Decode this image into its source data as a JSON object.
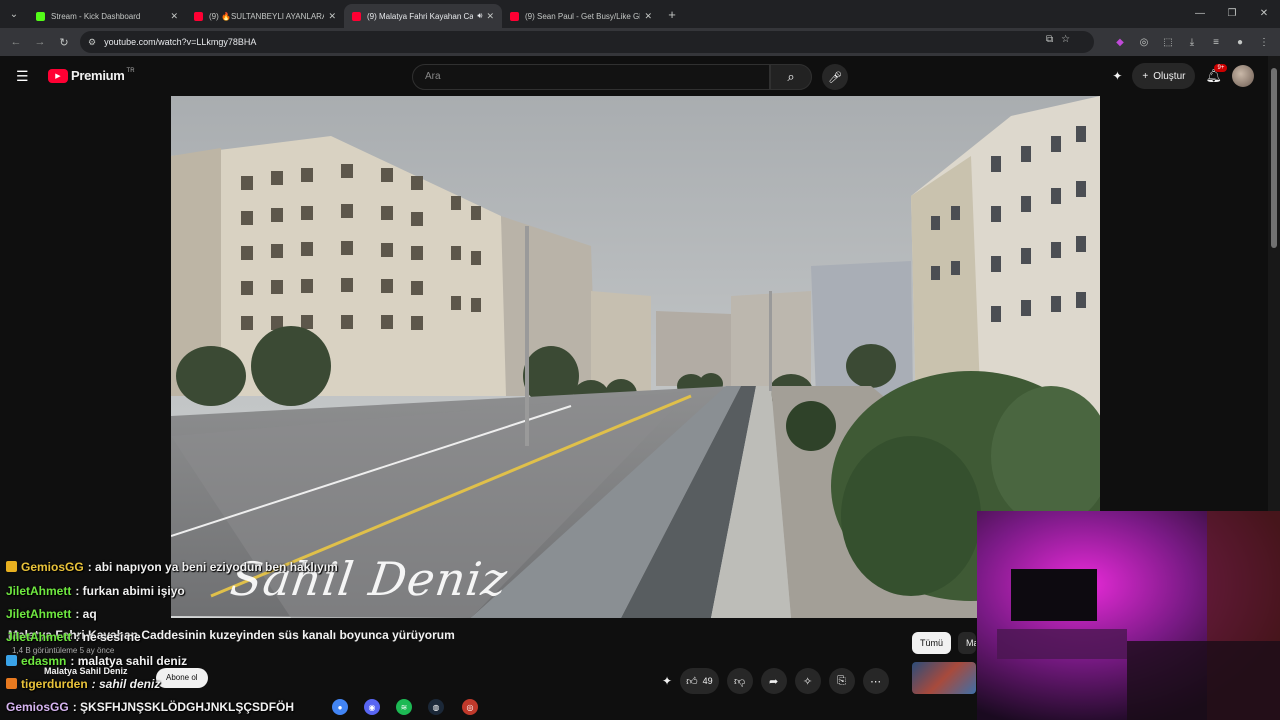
{
  "browser": {
    "tabs": [
      {
        "title": "Stream - Kick Dashboard",
        "favicon_color": "#53fc18",
        "active": false
      },
      {
        "title": "(9) 🔥SULTANBEYLI AYANLARA",
        "favicon_color": "#ff0033",
        "active": false
      },
      {
        "title": "(9) Malatya Fahri Kayahan Ca",
        "favicon_color": "#ff0033",
        "active": true
      },
      {
        "title": "(9) Sean Paul - Get Busy/Like Gl",
        "favicon_color": "#ff0033",
        "active": false
      }
    ],
    "url": "youtube.com/watch?v=LLkmgy78BHA"
  },
  "youtube": {
    "brand": "Premium",
    "country": "TR",
    "search_placeholder": "Ara",
    "create_label": "Oluştur",
    "notifications": "9+"
  },
  "video": {
    "watermark": "Sahil Deniz",
    "title": "Malatya Fahri Kayahan Caddesinin kuzeyinden süs kanalı boyunca yürüyorum",
    "meta": "1,4 B görüntüleme  5 ay önce",
    "channel": "Malatya Sahil Deniz",
    "subscribe_label": "Abone ol",
    "likes": "49",
    "chips": [
      "Tümü",
      "Ma"
    ]
  },
  "chat": [
    {
      "user": "GemiosGG",
      "user_color": "#e8c23a",
      "text": ": abi napıyon ya beni eziyodun ben haklıyım",
      "badge_color": "#e8b020"
    },
    {
      "user": "JiletAhmett",
      "user_color": "#6fe840",
      "text": ": furkan abimi işiyo",
      "badge_color": ""
    },
    {
      "user": "JiletAhmett",
      "user_color": "#6fe840",
      "text": ": aq",
      "badge_color": ""
    },
    {
      "user": "JiletAhmett",
      "user_color": "#6fe840",
      "text": ": ne sesi ne",
      "badge_color": ""
    },
    {
      "user": "edasmn",
      "user_color": "#6fe840",
      "text": ": malatya sahil deniz",
      "badge_color": "#3aa3e8"
    },
    {
      "user": "tigerdurden",
      "user_color": "#e8c23a",
      "text": ": sahil deniz",
      "badge_color": "#e87a20"
    },
    {
      "user": "GemiosGG",
      "user_color": "#d6b4f0",
      "text": ": ŞKSFHJNŞSKLÖDGHJNKLŞÇSDFÖH",
      "badge_color": ""
    }
  ]
}
